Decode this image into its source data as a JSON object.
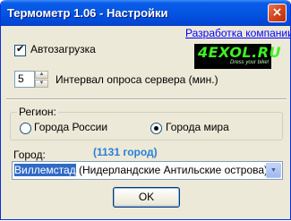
{
  "window": {
    "title": "Термометр 1.06 - Настройки",
    "close_label": "×"
  },
  "autostart": {
    "label": "Автозагрузка",
    "checked": true
  },
  "company_link": "Разработка компании",
  "logo": {
    "text": "4EXOL.RU",
    "tagline": "Dress your bike!"
  },
  "interval": {
    "value": "5",
    "label": "Интервал опроса сервера (мин.)"
  },
  "region": {
    "legend": "Регион:",
    "options": [
      {
        "label": "Города России",
        "selected": false
      },
      {
        "label": "Города мира",
        "selected": true
      }
    ]
  },
  "city": {
    "label": "Город:",
    "count": "(1131 город)",
    "selected_name": "Виллемстад",
    "selected_detail": " (Нидерландские Антильские острова)"
  },
  "ok_label": "OK",
  "colors": {
    "titlebar": "#0355e3",
    "logo_green": "#3ef221",
    "link": "#0000ff",
    "count_text": "#2a7fd8",
    "selection": "#316ac5"
  }
}
